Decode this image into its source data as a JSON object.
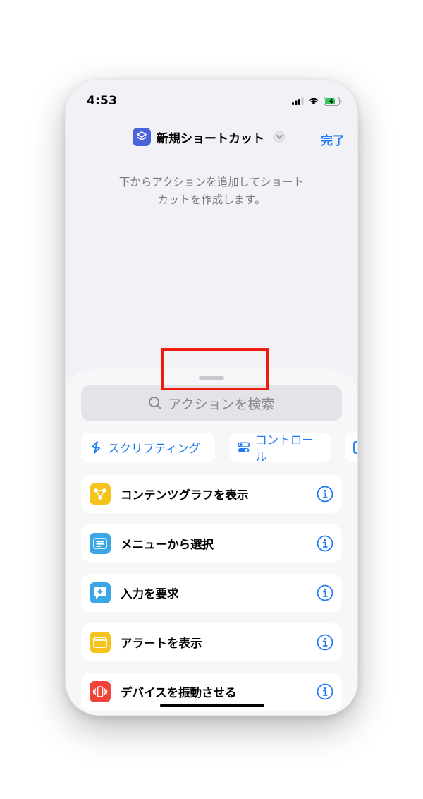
{
  "status": {
    "time": "4:53"
  },
  "nav": {
    "title": "新規ショートカット",
    "done_label": "完了"
  },
  "empty_hint": {
    "line1": "下からアクションを追加してショート",
    "line2": "カットを作成します。"
  },
  "search": {
    "placeholder": "アクションを検索"
  },
  "categories": [
    {
      "label": "スクリプティング",
      "icon": "scripting-icon"
    },
    {
      "label": "コントロール",
      "icon": "toggle-icon",
      "highlighted": true
    }
  ],
  "actions": [
    {
      "label": "コンテンツグラフを表示",
      "icon": "graph-icon",
      "color": "#f6c21c"
    },
    {
      "label": "メニューから選択",
      "icon": "menu-icon",
      "color": "#3aa6e6"
    },
    {
      "label": "入力を要求",
      "icon": "speech-bubble-plus-icon",
      "color": "#3aa6e6"
    },
    {
      "label": "アラートを表示",
      "icon": "window-icon",
      "color": "#f6c21c"
    },
    {
      "label": "デバイスを振動させる",
      "icon": "vibrate-icon",
      "color": "#f0443a"
    }
  ],
  "colors": {
    "accent": "#1e7bf2",
    "highlight": "#ec1c0e"
  }
}
